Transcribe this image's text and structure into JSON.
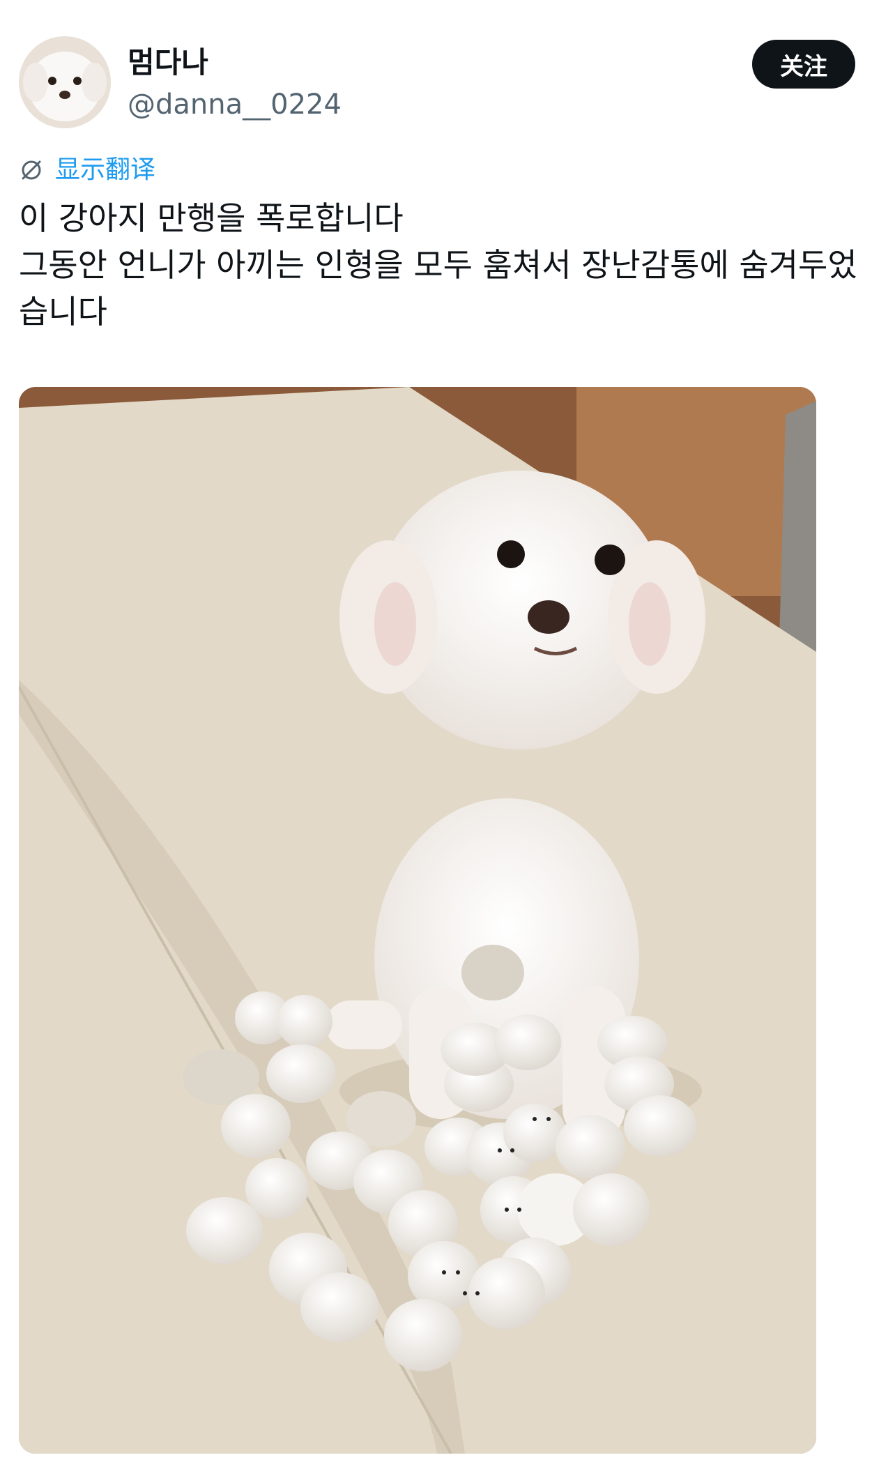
{
  "header": {
    "display_name": "멈다나",
    "handle": "@danna__0224",
    "follow_label": "关注",
    "avatar_alt": "profile photo of white poodle"
  },
  "translate": {
    "label": "显示翻译",
    "icon": "translate-icon"
  },
  "tweet": {
    "lines": [
      "이 강아지 만행을 폭로합니다",
      "그동안 언니가 아끼는 인형을 모두 훔쳐서 장난감통에 숨겨두었습니다"
    ]
  },
  "media": {
    "description_icon": "photo-media",
    "colors": {
      "floor": "#8a5a3a",
      "mat": "#e3d9c8",
      "dog": "#f5f1ee",
      "toy": "#f2efea"
    }
  },
  "colors": {
    "link": "#1d9bf0",
    "text": "#0f1419",
    "secondary": "#536471",
    "button_bg": "#0f1419"
  }
}
